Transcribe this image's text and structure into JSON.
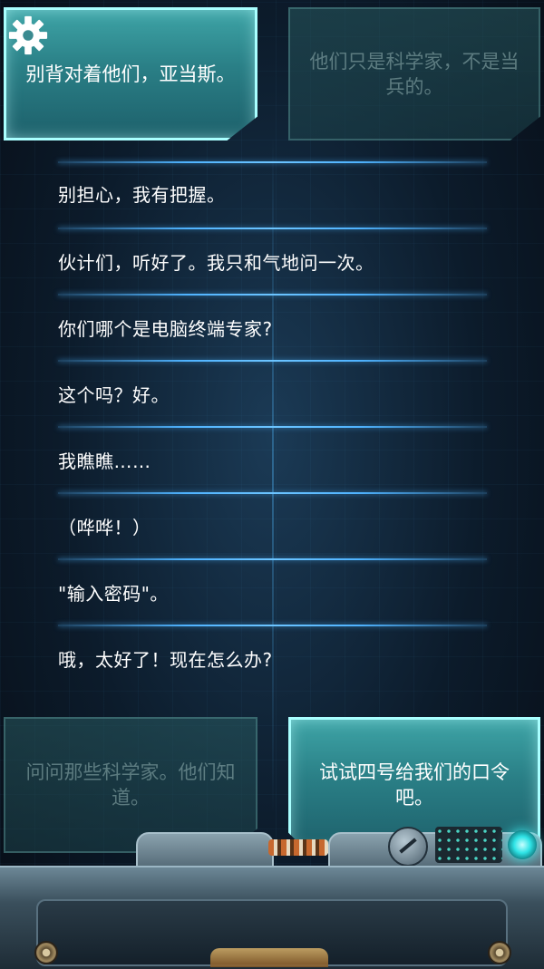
{
  "choices": {
    "top_left": {
      "text": "别背对着他们，亚当斯。",
      "state": "active"
    },
    "top_right": {
      "text": "他们只是科学家，不是当兵的。",
      "state": "inactive"
    },
    "bottom_left": {
      "text": "问问那些科学家。他们知道。",
      "state": "inactive"
    },
    "bottom_right": {
      "text": "试试四号给我们的口令吧。",
      "state": "active"
    }
  },
  "dialogue": [
    "别担心，我有把握。",
    "伙计们，听好了。我只和气地问一次。",
    "你们哪个是电脑终端专家?",
    "这个吗？好。",
    "我瞧瞧……",
    "（哗哗！）",
    "\"输入密码\"。",
    "哦，太好了！现在怎么办?"
  ],
  "icons": {
    "settings": "gear-icon",
    "console_knob": "knob-icon",
    "console_light": "led-icon"
  },
  "colors": {
    "active_choice": "#2a7f86",
    "active_border": "#a9ffff",
    "divider": "#4fb3ff",
    "led": "#2fe3e6"
  }
}
